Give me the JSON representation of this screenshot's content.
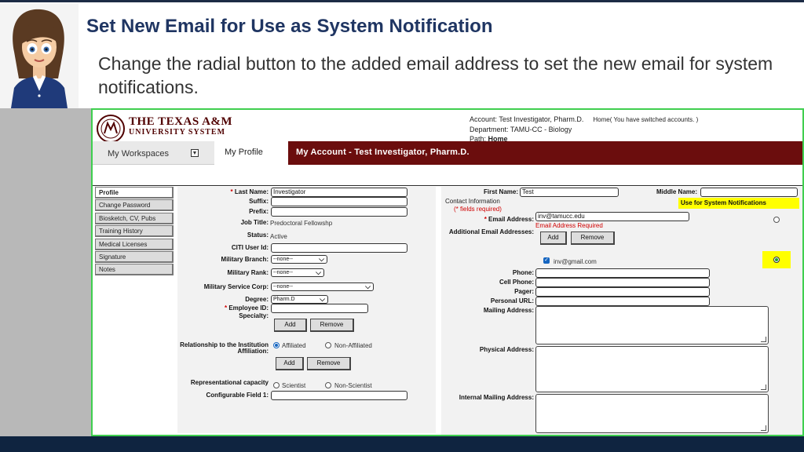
{
  "slide": {
    "title": "Set New Email for Use as System Notification",
    "description": "Change the radial button to the added email address to set the new email for system notifications."
  },
  "colors": {
    "title_blue": "#1f3562",
    "maroon": "#6b0d0d",
    "highlight_yellow": "#ffff00",
    "required_red": "#d00000",
    "frame_green": "#3fcf4f"
  },
  "app": {
    "logo": {
      "line1": "THE TEXAS A&M",
      "line2": "UNIVERSITY SYSTEM"
    },
    "account_line": "Account: Test Investigator, Pharm.D.",
    "home_switched": "Home( You have switched accounts. )",
    "department": "Department:  TAMU-CC - Biology",
    "path_label": "Path:",
    "path_value": "Home",
    "nav": {
      "workspaces": "My Workspaces",
      "profile": "My Profile"
    },
    "account_bar": "My Account - Test Investigator, Pharm.D."
  },
  "side_menu": [
    "Profile",
    "Change Password",
    "Biosketch, CV, Pubs",
    "Training History",
    "Medical Licenses",
    "Signature",
    "Notes"
  ],
  "form": {
    "last_name_label": "Last Name:",
    "last_name_value": "Investigator",
    "suffix_label": "Suffix:",
    "prefix_label": "Prefix:",
    "job_title_label": "Job Title:",
    "job_title_value": "Predoctoral Fellowshp",
    "status_label": "Status:",
    "status_value": "Active",
    "citi_label": "CITI User Id:",
    "military_branch_label": "Military Branch:",
    "military_branch_value": "--none--",
    "military_rank_label": "Military Rank:",
    "military_rank_value": "--none--",
    "military_corp_label": "Military Service Corp:",
    "military_corp_value": "--none--",
    "degree_label": "Degree:",
    "degree_value": "Pharm.D",
    "employee_id_label": "Employee ID:",
    "specialty_label": "Specialty:",
    "add_label": "Add",
    "remove_label": "Remove",
    "relationship_label": "Relationship to the Institution Affiliation:",
    "affiliated_label": "Affiliated",
    "non_affiliated_label": "Non-Affiliated",
    "rep_capacity_label": "Representational capacity",
    "scientist_label": "Scientist",
    "non_scientist_label": "Non-Scientist",
    "config_field_label": "Configurable Field 1:"
  },
  "right": {
    "first_name_label": "First Name:",
    "first_name_value": "Test",
    "middle_name_label": "Middle Name:",
    "contact_info_label": "Contact Information",
    "fields_required": "(* fields required)",
    "use_for_notifications": "Use for System Notifications",
    "email_label": "Email Address:",
    "email_value": "inv@tamucc.edu",
    "email_required": "Email Address Required",
    "additional_email_label": "Additional Email Addresses:",
    "add_label": "Add",
    "remove_label": "Remove",
    "added_email": "inv@gmail.com",
    "phone_label": "Phone:",
    "cell_label": "Cell Phone:",
    "pager_label": "Pager:",
    "personal_url_label": "Personal URL:",
    "mailing_label": "Mailing Address:",
    "physical_label": "Physical Address:",
    "internal_label": "Internal Mailing Address:"
  }
}
